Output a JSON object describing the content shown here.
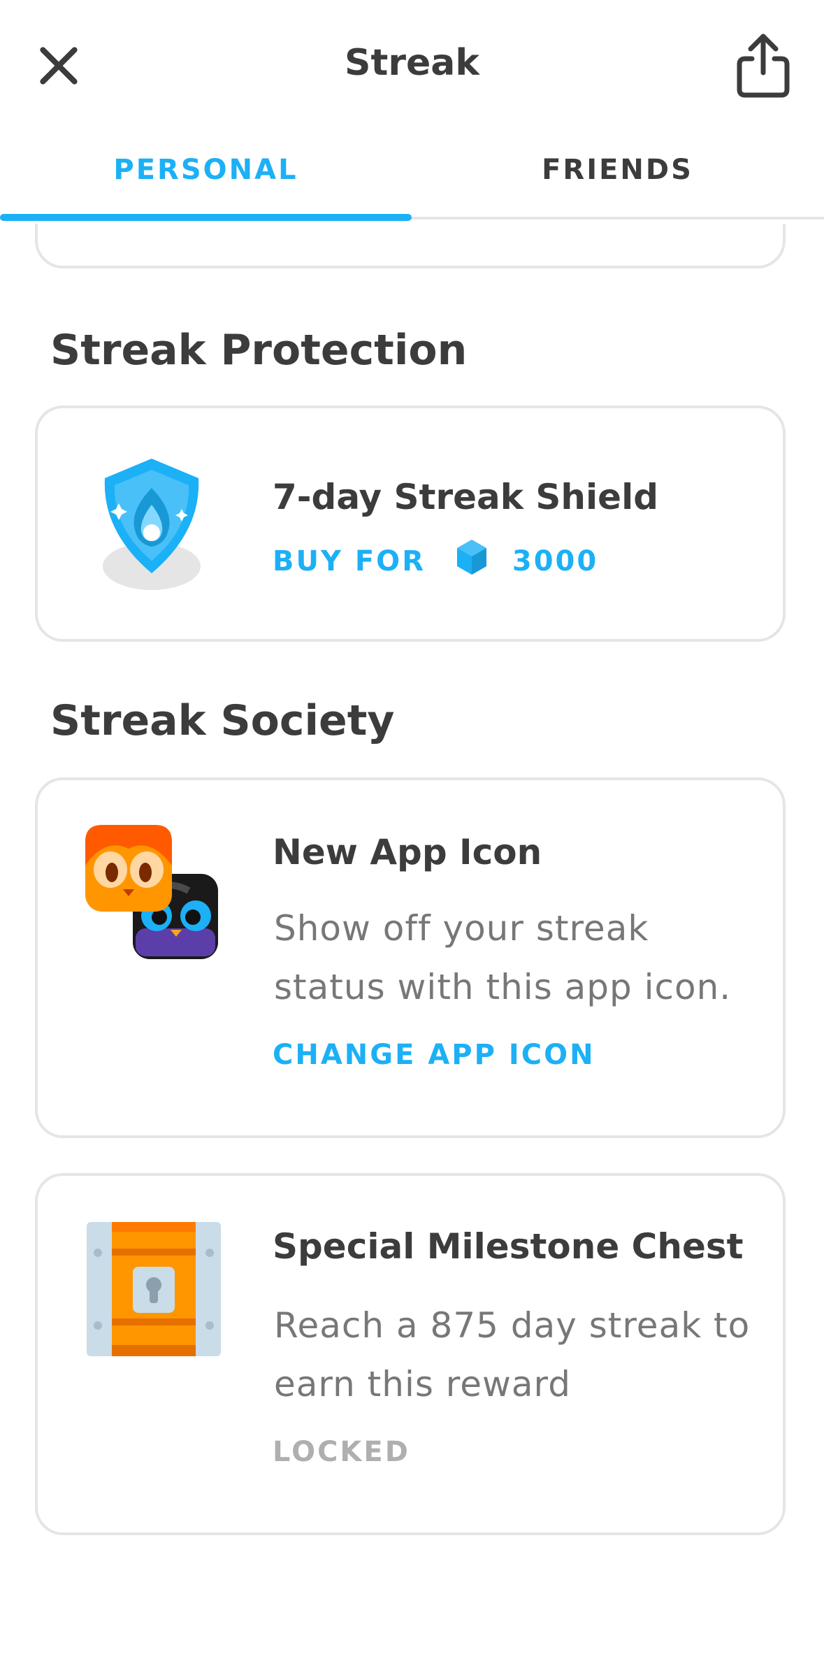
{
  "header": {
    "title": "Streak"
  },
  "tabs": [
    {
      "label": "PERSONAL",
      "active": true
    },
    {
      "label": "FRIENDS",
      "active": false
    }
  ],
  "colors": {
    "accent": "#1cb0f6",
    "text": "#3c3c3c",
    "muted": "#777777",
    "locked": "#afafaf",
    "border": "#e5e5e5"
  },
  "streak_protection": {
    "heading": "Streak Protection",
    "item": {
      "title": "7-day Streak Shield",
      "buy_label": "BUY FOR",
      "price": "3000",
      "icon": "streak-shield-icon",
      "currency_icon": "gem-icon"
    }
  },
  "streak_society": {
    "heading": "Streak Society",
    "items": [
      {
        "title": "New App Icon",
        "description": "Show off your streak status with this app icon.",
        "action": "CHANGE APP ICON",
        "icon": "app-icon-preview"
      },
      {
        "title": "Special Milestone Chest",
        "description": "Reach a 875 day streak to earn this reward",
        "status": "LOCKED",
        "icon": "chest-icon"
      }
    ]
  }
}
